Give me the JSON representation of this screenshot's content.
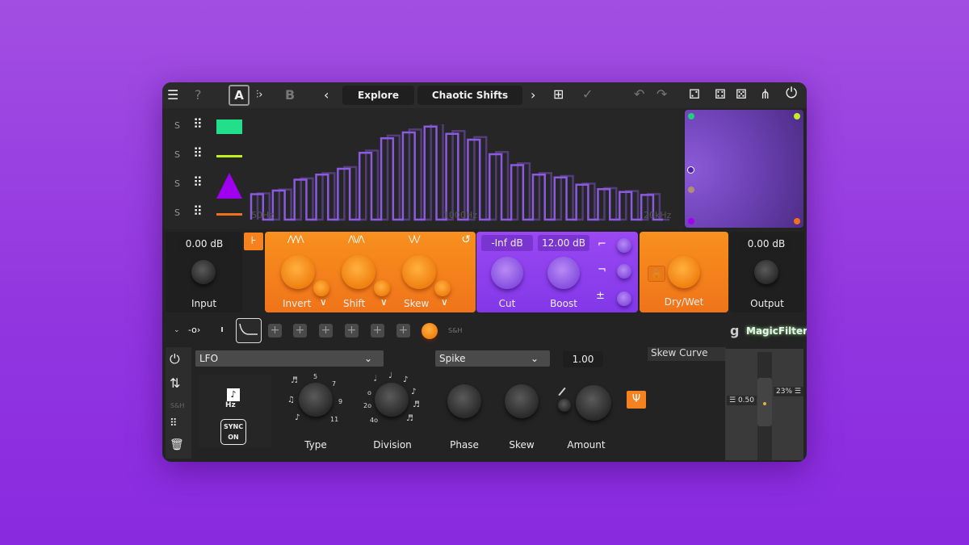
{
  "topbar": {
    "menu_icon": "hamburger-icon",
    "help": "?",
    "preset_a": "A",
    "preset_b": "B",
    "prev": "‹",
    "next": "›",
    "category": "Explore",
    "preset_name": "Chaotic Shifts"
  },
  "layers": [
    {
      "solo": "S",
      "shape": "rectangle",
      "color": "#22e08a"
    },
    {
      "solo": "S",
      "shape": "line",
      "color": "#c0f020"
    },
    {
      "solo": "S",
      "shape": "triangle",
      "color": "#a000f0"
    },
    {
      "solo": "S",
      "shape": "line",
      "color": "#f07020"
    }
  ],
  "spectrum": {
    "labels": [
      "50Hz",
      "1000Hz",
      "20kHz"
    ],
    "color": "#8a5ae0"
  },
  "xy_pad": {
    "corner_colors": [
      "#20d080",
      "#c0f020",
      "#a000f0",
      "#f07020"
    ]
  },
  "input": {
    "value": "0.00 dB",
    "label": "Input"
  },
  "output": {
    "value": "0.00 dB",
    "label": "Output"
  },
  "distortion": {
    "knobs": [
      {
        "label": "Invert"
      },
      {
        "label": "Shift"
      },
      {
        "label": "Skew"
      }
    ],
    "color": "#f5821e"
  },
  "filter": {
    "cut_value": "-Inf dB",
    "boost_value": "12.00 dB",
    "cut_label": "Cut",
    "boost_label": "Boost",
    "color": "#9040f0"
  },
  "mix": {
    "label": "Dry/Wet"
  },
  "mod_row": {
    "sh_label": "S&H",
    "brand": "MagicFilter"
  },
  "sidebar": {
    "sh": "S&H"
  },
  "lfo": {
    "source": "LFO",
    "shape": "Spike",
    "amount_value": "1.00",
    "hz": "Hz",
    "sync_line1": "SYNC",
    "sync_line2": "ON",
    "type_ticks": [
      "5",
      "7",
      "9",
      "11"
    ],
    "division_ticks": [
      "o",
      "2o",
      "4o"
    ],
    "knob_labels": {
      "type": "Type",
      "division": "Division",
      "phase": "Phase",
      "skew": "Skew",
      "amount": "Amount"
    }
  },
  "skew_curve": {
    "title": "Skew Curve",
    "left_value": "0.50",
    "right_value": "23%"
  }
}
